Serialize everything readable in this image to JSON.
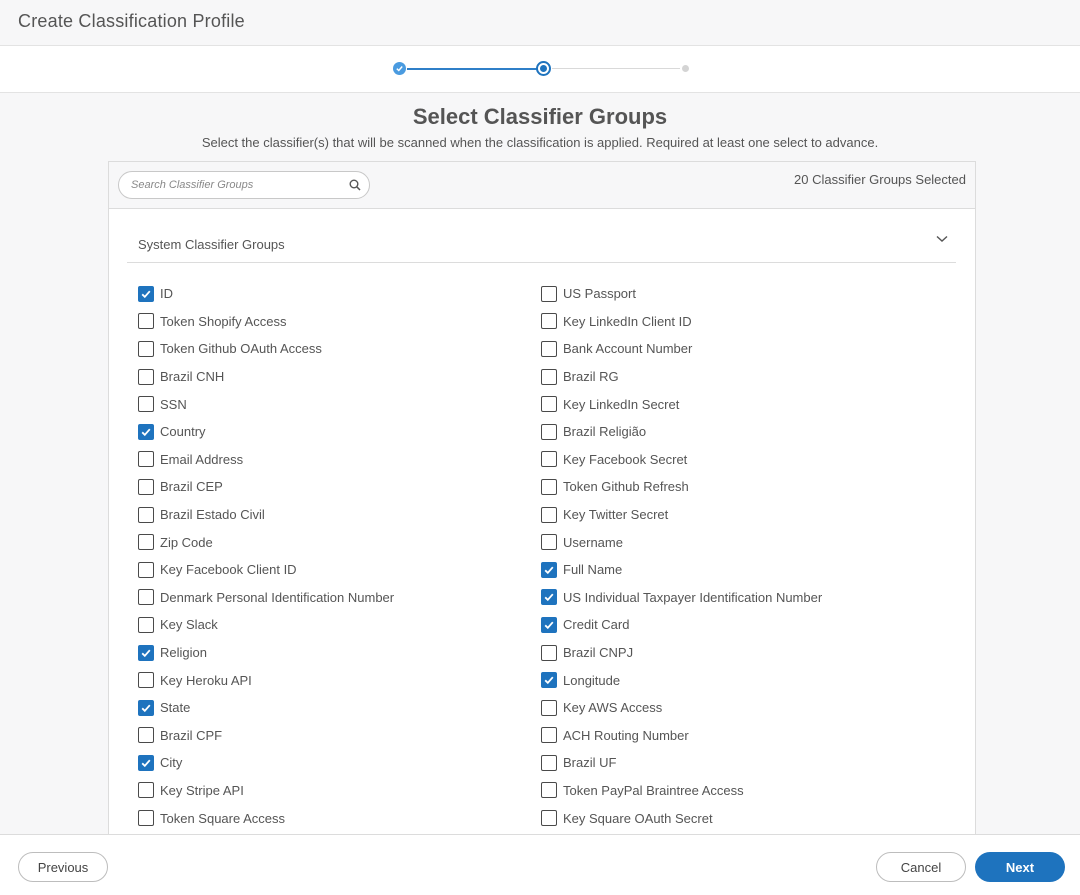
{
  "window": {
    "title": "Create Classification Profile"
  },
  "stepper": {
    "current_step": 2,
    "total_steps": 3,
    "completed_steps": 1
  },
  "main": {
    "title": "Select Classifier Groups",
    "subtitle": "Select the classifier(s) that will be scanned when the classification is applied. Required at least one select to advance."
  },
  "search": {
    "placeholder": "Search Classifier Groups",
    "value": ""
  },
  "selected_count_label": "20 Classifier Groups Selected",
  "section": {
    "title": "System Classifier Groups",
    "expanded": true
  },
  "classifiers": {
    "left": [
      {
        "label": "ID",
        "checked": true
      },
      {
        "label": "Token Shopify Access",
        "checked": false
      },
      {
        "label": "Token Github OAuth Access",
        "checked": false
      },
      {
        "label": "Brazil CNH",
        "checked": false
      },
      {
        "label": "SSN",
        "checked": false
      },
      {
        "label": "Country",
        "checked": true
      },
      {
        "label": "Email Address",
        "checked": false
      },
      {
        "label": "Brazil CEP",
        "checked": false
      },
      {
        "label": "Brazil Estado Civil",
        "checked": false
      },
      {
        "label": "Zip Code",
        "checked": false
      },
      {
        "label": "Key Facebook Client ID",
        "checked": false
      },
      {
        "label": "Denmark Personal Identification Number",
        "checked": false
      },
      {
        "label": "Key Slack",
        "checked": false
      },
      {
        "label": "Religion",
        "checked": true
      },
      {
        "label": "Key Heroku API",
        "checked": false
      },
      {
        "label": "State",
        "checked": true
      },
      {
        "label": "Brazil CPF",
        "checked": false
      },
      {
        "label": "City",
        "checked": true
      },
      {
        "label": "Key Stripe API",
        "checked": false
      },
      {
        "label": "Token Square Access",
        "checked": false
      }
    ],
    "right": [
      {
        "label": "US Passport",
        "checked": false
      },
      {
        "label": "Key LinkedIn Client ID",
        "checked": false
      },
      {
        "label": "Bank Account Number",
        "checked": false
      },
      {
        "label": "Brazil RG",
        "checked": false
      },
      {
        "label": "Key LinkedIn Secret",
        "checked": false
      },
      {
        "label": "Brazil Religião",
        "checked": false
      },
      {
        "label": "Key Facebook Secret",
        "checked": false
      },
      {
        "label": "Token Github Refresh",
        "checked": false
      },
      {
        "label": "Key Twitter Secret",
        "checked": false
      },
      {
        "label": "Username",
        "checked": false
      },
      {
        "label": "Full Name",
        "checked": true
      },
      {
        "label": "US Individual Taxpayer Identification Number",
        "checked": true
      },
      {
        "label": "Credit Card",
        "checked": true
      },
      {
        "label": "Brazil CNPJ",
        "checked": false
      },
      {
        "label": "Longitude",
        "checked": true
      },
      {
        "label": "Key AWS Access",
        "checked": false
      },
      {
        "label": "ACH Routing Number",
        "checked": false
      },
      {
        "label": "Brazil UF",
        "checked": false
      },
      {
        "label": "Token PayPal Braintree Access",
        "checked": false
      },
      {
        "label": "Key Square OAuth Secret",
        "checked": false
      }
    ]
  },
  "footer": {
    "previous_label": "Previous",
    "cancel_label": "Cancel",
    "next_label": "Next"
  },
  "colors": {
    "accent": "#1e73be",
    "step_done": "#4a9be0",
    "text": "#555555"
  }
}
